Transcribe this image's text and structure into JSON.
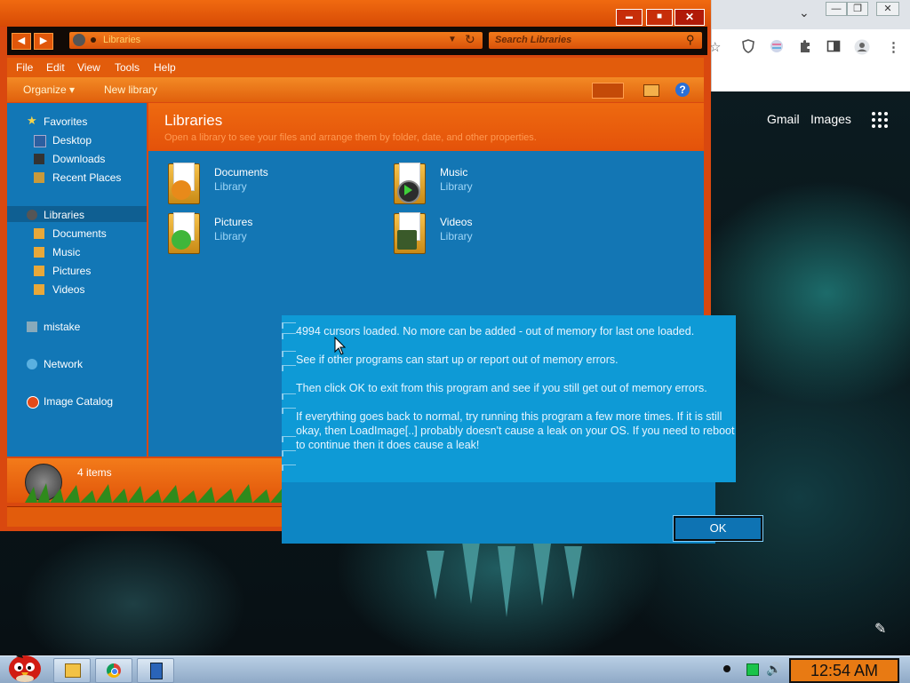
{
  "chrome": {
    "caption_min": "—",
    "caption_restore": "❐",
    "caption_close": "✕",
    "chevron": "⌄",
    "toolbar_icons": [
      "star-icon",
      "shield-icon",
      "extension-badge-icon",
      "puzzle-icon",
      "sidebar-icon",
      "profile-icon",
      "kebab-menu-icon"
    ],
    "links": {
      "gmail": "Gmail",
      "images": "Images"
    }
  },
  "explorer": {
    "caption_buttons": {
      "minimize": "▬",
      "maximize": "■",
      "close": "✕"
    },
    "address": {
      "path": "Libraries"
    },
    "search": {
      "placeholder": "Search Libraries"
    },
    "menu": [
      "File",
      "Edit",
      "View",
      "Tools",
      "Help"
    ],
    "commands": {
      "organize": "Organize ▾",
      "new_library": "New library",
      "help": "?"
    },
    "nav": {
      "favorites": {
        "label": "Favorites",
        "items": [
          "Desktop",
          "Downloads",
          "Recent Places"
        ]
      },
      "libraries": {
        "label": "Libraries",
        "items": [
          "Documents",
          "Music",
          "Pictures",
          "Videos"
        ]
      },
      "homegroup": "mistake",
      "network": "Network",
      "catalog": "Image Catalog"
    },
    "content": {
      "title": "Libraries",
      "subtitle": "Open a library to see your files and arrange them by folder, date, and other properties.",
      "libraries": [
        {
          "name": "Documents",
          "type": "Library",
          "badge_color": "#e88a1a"
        },
        {
          "name": "Music",
          "type": "Library",
          "badge_color": "#2c2c2c"
        },
        {
          "name": "Pictures",
          "type": "Library",
          "badge_color": "#3fb63a"
        },
        {
          "name": "Videos",
          "type": "Library",
          "badge_color": "#3a5a2a"
        }
      ]
    },
    "details": {
      "item_count": "4 items"
    }
  },
  "dialog": {
    "message": [
      "4994 cursors loaded. No more can be added - out of memory for last one loaded.",
      "See if other programs can start up or report out of memory errors.",
      "Then click OK to exit from this program and see if you still get out of memory errors.",
      "If everything goes back to normal, try running this program a few more times. If it is still okay, then LoadImage[..] probably doesn't cause a leak on your OS. If you need to reboot to continue then it does cause a leak!"
    ],
    "ok_label": "OK"
  },
  "taskbar": {
    "clock": "12:54 AM",
    "pinned": [
      "explorer-icon",
      "chrome-icon",
      "app-icon"
    ]
  },
  "colors": {
    "explorer_orange": "#e25c0c",
    "explorer_blue": "#1376b4",
    "dialog_blue": "#0e9ad6",
    "clock_orange": "#e87a13"
  }
}
